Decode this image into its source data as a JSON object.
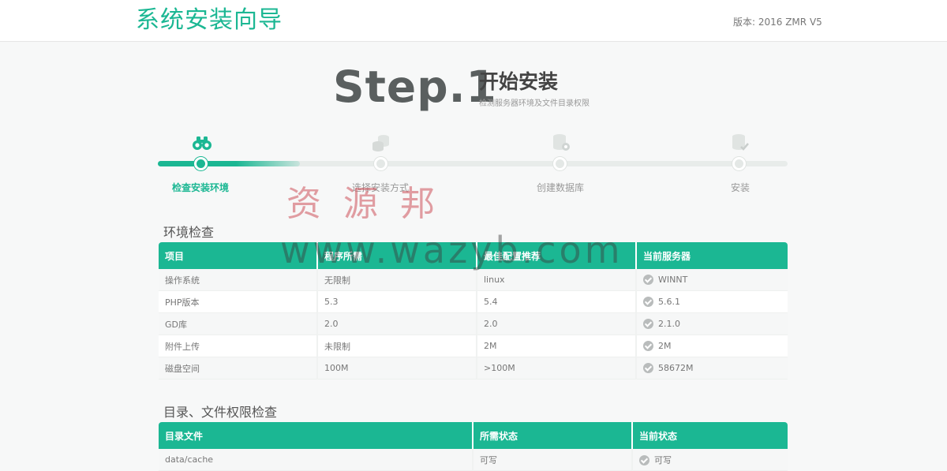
{
  "header": {
    "title": "系统安装向导",
    "version": "版本: 2016 ZMR V5"
  },
  "step": {
    "number": "Step.1",
    "title": "开始安装",
    "subtitle": "检测服务器环境及文件目录权限"
  },
  "progress": {
    "steps": [
      {
        "label": "检查安装环境",
        "icon": "binoculars-icon",
        "active": true
      },
      {
        "label": "选择安装方式",
        "icon": "coins-stack-icon",
        "active": false
      },
      {
        "label": "创建数据库",
        "icon": "database-settings-icon",
        "active": false
      },
      {
        "label": "安装",
        "icon": "database-check-icon",
        "active": false
      }
    ]
  },
  "watermark": {
    "cn": "资源邦",
    "url": "www.wazyb.com"
  },
  "env": {
    "title": "环境检查",
    "headers": [
      "项目",
      "程序所需",
      "最佳配置推荐",
      "当前服务器"
    ],
    "rows": [
      [
        "操作系统",
        "无限制",
        "linux",
        "WINNT"
      ],
      [
        "PHP版本",
        "5.3",
        "5.4",
        "5.6.1"
      ],
      [
        "GD库",
        "2.0",
        "2.0",
        "2.1.0"
      ],
      [
        "附件上传",
        "未限制",
        "2M",
        "2M"
      ],
      [
        "磁盘空间",
        "100M",
        ">100M",
        "58672M"
      ]
    ]
  },
  "perm": {
    "title": "目录、文件权限检查",
    "headers": [
      "目录文件",
      "所需状态",
      "当前状态"
    ],
    "rows": [
      [
        "data/cache",
        "可写",
        "可写"
      ]
    ]
  },
  "colors": {
    "accent": "#1bb793",
    "check": "#b9bcbc"
  }
}
